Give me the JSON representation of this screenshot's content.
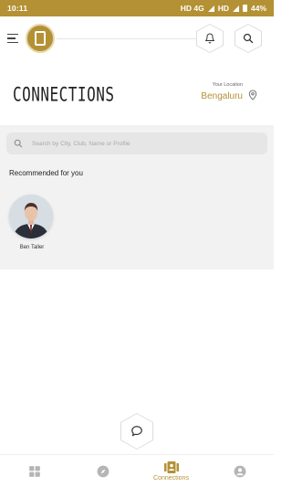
{
  "status_bar": {
    "time": "10:11",
    "network": "HD 4G",
    "network2": "HD",
    "battery": "44%"
  },
  "header": {
    "logo_icon": "app-logo",
    "bell_icon": "bell-icon",
    "search_icon": "search-icon"
  },
  "page": {
    "title": "CONNECTIONS",
    "location_label": "Your Location",
    "location_value": "Bengaluru"
  },
  "search": {
    "placeholder": "Search by City, Club, Name or Profile"
  },
  "recommended": {
    "title": "Recommended for you",
    "profiles": [
      {
        "name": "Ben Taller"
      }
    ]
  },
  "bottom_nav": {
    "items": [
      {
        "icon": "grid-icon",
        "label": ""
      },
      {
        "icon": "compass-icon",
        "label": ""
      },
      {
        "icon": "connections-icon",
        "label": "Connections",
        "active": true
      },
      {
        "icon": "profile-icon",
        "label": ""
      }
    ]
  },
  "colors": {
    "accent": "#b39134",
    "panel": "#f2f2f2",
    "inactive_icon": "#b5b5b5"
  }
}
